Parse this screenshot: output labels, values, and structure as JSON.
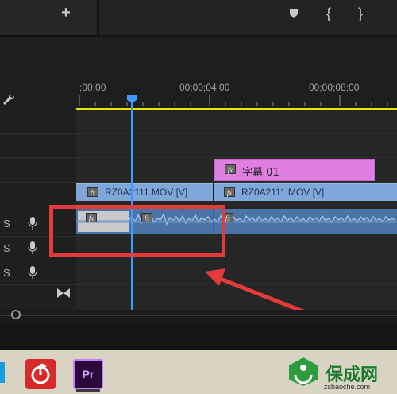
{
  "toolbar": {
    "add_symbol": "+",
    "brace_open": "{",
    "brace_close": "}"
  },
  "timeline": {
    "timecodes": [
      ";00;00",
      "00;00;04;00",
      "00;00;08;00"
    ]
  },
  "tracks": {
    "audio_labels": [
      "S",
      "S",
      "S"
    ]
  },
  "clips": {
    "title_clip": {
      "fx": "fx",
      "name": "字幕 01"
    },
    "video_clip_1": {
      "fx": "fx",
      "name": "RZ0A2111.MOV [V]"
    },
    "video_clip_2": {
      "fx": "fx",
      "name": "RZ0A2111.MOV [V]"
    },
    "audio_fx_labels": [
      "fx",
      "fx",
      "fx"
    ]
  },
  "colors": {
    "title_clip": "#e07fe2",
    "video_clip": "#7fa7d9",
    "audio_clip": "#4a74a6",
    "playhead": "#3f9aff",
    "work_area_bar": "#e6e600",
    "annotation": "#e53a3a"
  },
  "taskbar": {
    "apps": [
      "NetEase Cloud Music",
      "Pr"
    ],
    "pr_label": "Pr"
  },
  "watermark": {
    "name": "保成网",
    "url": "zsbaoche.com"
  }
}
